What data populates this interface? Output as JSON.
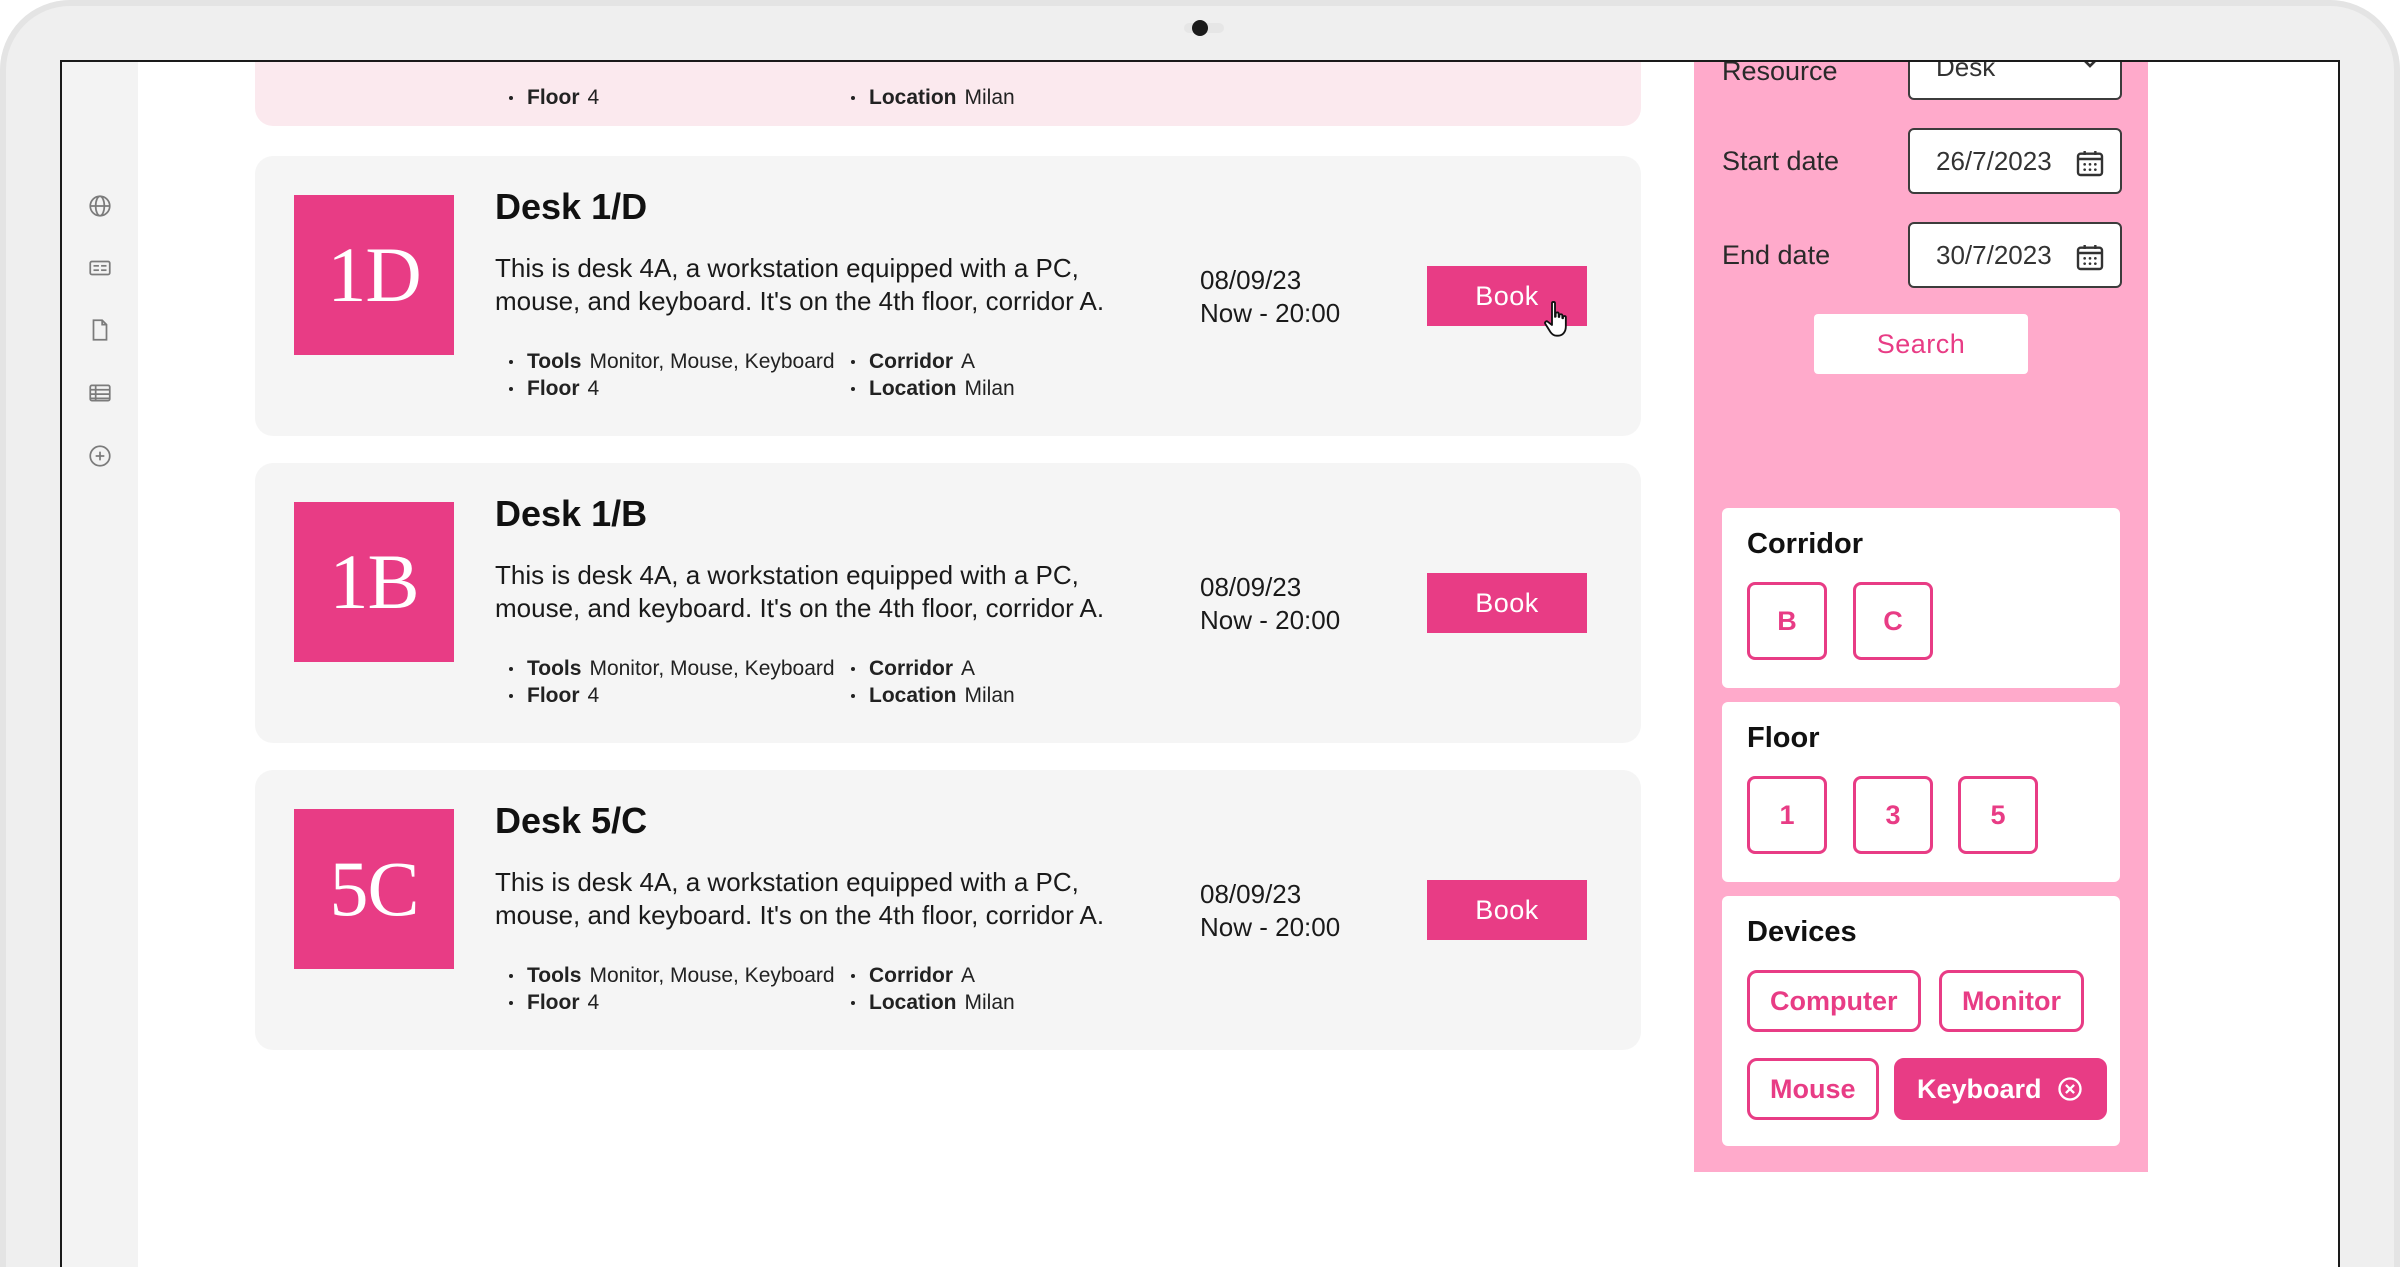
{
  "rail": {
    "icons": [
      "globe-icon",
      "id-card-icon",
      "document-icon",
      "table-icon",
      "add-circle-icon"
    ]
  },
  "partial_card": {
    "floor_label": "Floor",
    "floor_value": "4",
    "location_label": "Location",
    "location_value": "Milan"
  },
  "cards": [
    {
      "tile": "1D",
      "title": "Desk 1/D",
      "description": "This is desk 4A, a workstation equipped with a PC, mouse, and keyboard. It's on the 4th floor, corridor A.",
      "tools_label": "Tools",
      "tools_value": "Monitor, Mouse, Keyboard",
      "floor_label": "Floor",
      "floor_value": "4",
      "corridor_label": "Corridor",
      "corridor_value": "A",
      "location_label": "Location",
      "location_value": "Milan",
      "date": "08/09/23",
      "time": "Now - 20:00",
      "book_label": "Book"
    },
    {
      "tile": "1B",
      "title": "Desk 1/B",
      "description": "This is desk 4A, a workstation equipped with a PC, mouse, and keyboard. It's on the 4th floor, corridor A.",
      "tools_label": "Tools",
      "tools_value": "Monitor, Mouse, Keyboard",
      "floor_label": "Floor",
      "floor_value": "4",
      "corridor_label": "Corridor",
      "corridor_value": "A",
      "location_label": "Location",
      "location_value": "Milan",
      "date": "08/09/23",
      "time": "Now - 20:00",
      "book_label": "Book"
    },
    {
      "tile": "5C",
      "title": "Desk 5/C",
      "description": "This is desk 4A, a workstation equipped with a PC, mouse, and keyboard. It's on the 4th floor, corridor A.",
      "tools_label": "Tools",
      "tools_value": "Monitor, Mouse, Keyboard",
      "floor_label": "Floor",
      "floor_value": "4",
      "corridor_label": "Corridor",
      "corridor_value": "A",
      "location_label": "Location",
      "location_value": "Milan",
      "date": "08/09/23",
      "time": "Now - 20:00",
      "book_label": "Book"
    }
  ],
  "filters": {
    "resource_label": "Resource",
    "resource_value": "Desk",
    "start_label": "Start date",
    "start_value": "26/7/2023",
    "end_label": "End date",
    "end_value": "30/7/2023",
    "search_label": "Search",
    "corridor": {
      "title": "Corridor",
      "options": [
        "B",
        "C"
      ]
    },
    "floor": {
      "title": "Floor",
      "options": [
        "1",
        "3",
        "5"
      ]
    },
    "devices": {
      "title": "Devices",
      "options": [
        "Computer",
        "Monitor",
        "Mouse",
        "Keyboard"
      ],
      "selected": "Keyboard"
    }
  },
  "colors": {
    "accent": "#e83c85",
    "panel": "#ffaacb",
    "card": "#f5f5f5",
    "partial_card": "#fbe9ee"
  }
}
